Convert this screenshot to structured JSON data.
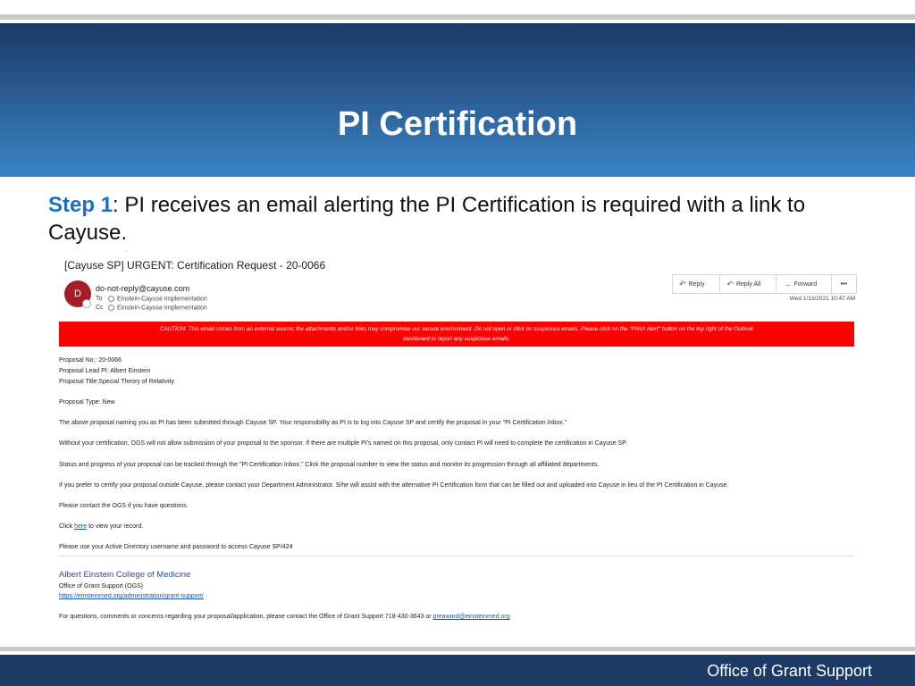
{
  "slide": {
    "title": "PI Certification",
    "step_label": "Step 1",
    "step_text": ": PI receives an email alerting the PI Certification is required with a link to Cayuse.",
    "footer": "Office of Grant Support"
  },
  "email": {
    "subject": "[Cayuse SP] URGENT: Certification Request - 20-0066",
    "avatar_initial": "D",
    "from": "do-not-reply@cayuse.com",
    "to_label": "To",
    "to": "Einstein-Cayuse Implementation",
    "cc_label": "Cc",
    "cc": "Einstein-Cayuse Implementation",
    "actions": {
      "reply": "Reply",
      "reply_all": "Reply All",
      "forward": "Forward",
      "more": "•••"
    },
    "date": "Wed 1/13/2021 10:47 AM",
    "caution_line1": "CAUTION: This email comes from an external source; the attachments and/or links may compromise our secure environment. Do not open or click on suspicious emails. Please click on the \"Phish Alert\" button on the top right of the Outlook",
    "caution_line2": "dashboard to report any suspicious emails.",
    "body": {
      "proposal_no": "Proposal No.: 20-0066",
      "lead_pi": "Proposal Lead PI: Albert Einstein",
      "proposal_title": "Proposal Title:Special Theory of Relativity",
      "proposal_type": "Proposal Type: New",
      "para1": "The above proposal naming you as PI has been submitted through Cayuse SP. Your responsibility as PI is to log into Cayuse SP and certify the proposal in your \"PI Certification Inbox.\"",
      "para2": "Without your certification, OGS will not allow submission of your proposal to the sponsor. If there are multiple PI's named on this proposal, only contact PI will need to complete the  certification in Cayuse SP.",
      "para3": "Status and progress of your proposal can be tracked through the \"PI Certification Inbox.\" Click the proposal number to view the status and monitor its progression through all affiliated departments.",
      "para4": "If you prefer to certify your proposal outside Cayuse, please contact your Department Administrator. S/he will assist with the alternative PI Certification form that can be filled out and uploaded into Cayuse in lieu of the PI Certification in Cayuse.",
      "para5": "Please contact the OGS if you have questions.",
      "click_prefix": "Click ",
      "click_link": "here",
      "click_suffix": " to view your record.",
      "para6": "Please use your Active Directory username and password to access Cayuse SP/424"
    },
    "signature": {
      "name": "Albert Einstein College of Medicine",
      "office": "Office of Grant Support (OGS)",
      "url": "https://einsteinmed.org/administration/grant-support/",
      "questions_text": "For questions, comments or concerns regarding your proposal/application, please contact the Office of Grant Support 718-430-3643 or ",
      "email": "preaward@einsteinmed.org"
    }
  }
}
